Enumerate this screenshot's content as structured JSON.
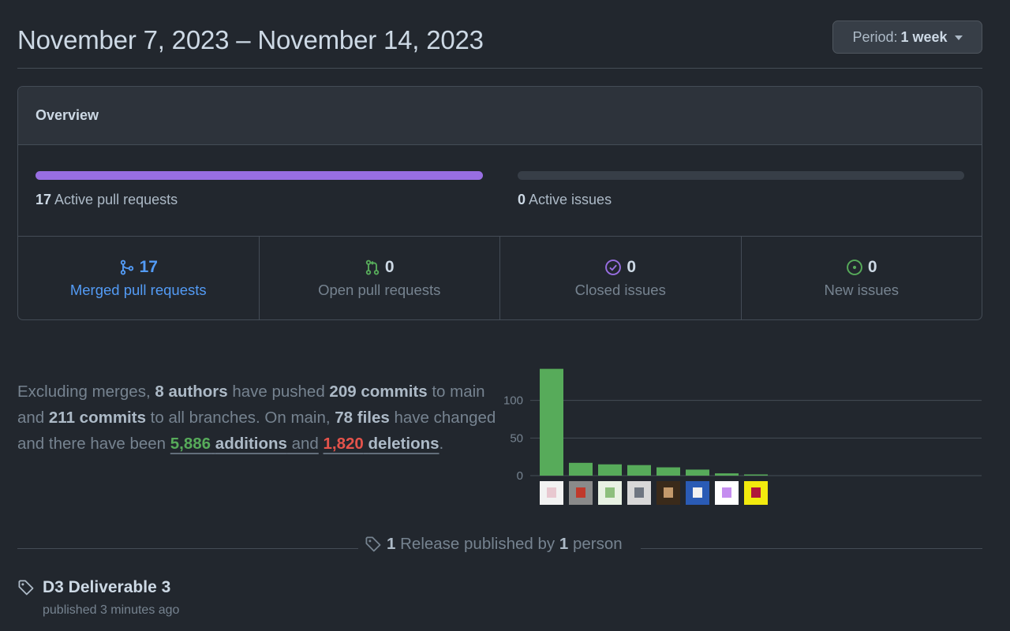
{
  "header": {
    "date_range": "November 7, 2023 – November 14, 2023",
    "period_label": "Period:",
    "period_value": "1 week"
  },
  "overview": {
    "title": "Overview",
    "active_prs": {
      "count": "17",
      "label": "Active pull requests",
      "progress": 1.0,
      "color": "#986ee2"
    },
    "active_issues": {
      "count": "0",
      "label": "Active issues",
      "progress": 0.0
    },
    "stats": [
      {
        "icon": "git-merge-icon",
        "value": "17",
        "label": "Merged pull requests",
        "color": "#539bf5"
      },
      {
        "icon": "git-pull-request-icon",
        "value": "0",
        "label": "Open pull requests",
        "color": "#57ab5a"
      },
      {
        "icon": "issue-closed-icon",
        "value": "0",
        "label": "Closed issues",
        "color": "#986ee2"
      },
      {
        "icon": "issue-opened-icon",
        "value": "0",
        "label": "New issues",
        "color": "#57ab5a"
      }
    ]
  },
  "summary": {
    "t1": "Excluding merges, ",
    "authors": "8 authors",
    "t2": " have pushed ",
    "commits_main": "209 commits",
    "t3": " to main and ",
    "commits_all": "211 commits",
    "t4": " to all branches. On main, ",
    "files": "78 files",
    "t5": " have changed and there have been ",
    "additions_num": "5,886",
    "additions_word": "additions",
    "t6": " and",
    "deletions_num": "1,820",
    "deletions_word": "deletions",
    "t7": "."
  },
  "chart_data": {
    "type": "bar",
    "categories": [
      "author-1",
      "author-2",
      "author-3",
      "author-4",
      "author-5",
      "author-6",
      "author-7",
      "author-8"
    ],
    "values": [
      142,
      17,
      15,
      14,
      11,
      8,
      3,
      1
    ],
    "yticks": [
      "0",
      "50",
      "100"
    ],
    "ylim": [
      0,
      150
    ],
    "bar_color": "#57ab5a",
    "grid": true
  },
  "releases": {
    "count": "1",
    "t_mid": "Release published by",
    "people": "1",
    "t_end": "person",
    "items": [
      {
        "icon": "tag-icon",
        "title": "D3 Deliverable 3",
        "subtitle": "published 3 minutes ago"
      }
    ]
  },
  "colors": {
    "bg": "#22272e",
    "border": "#444c56",
    "accent_blue": "#539bf5",
    "green": "#57ab5a",
    "red": "#e5534b",
    "purple": "#986ee2"
  }
}
